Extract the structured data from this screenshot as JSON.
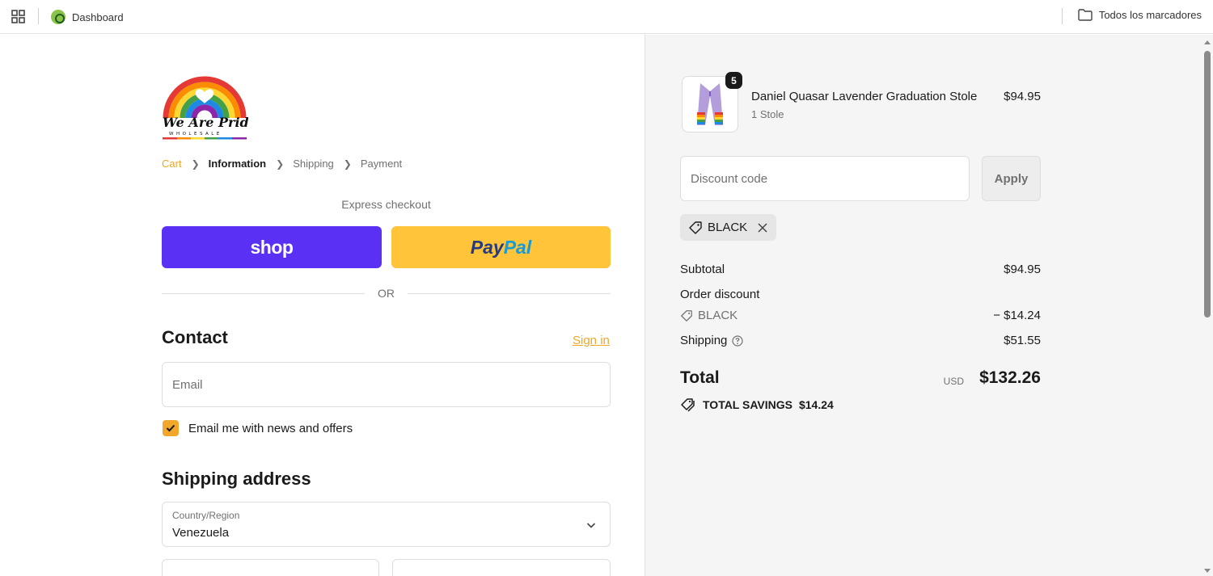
{
  "bookmarks": {
    "dashboard_label": "Dashboard",
    "all_bookmarks_label": "Todos los marcadores"
  },
  "brand": {
    "logo_text": "We Are Pride",
    "logo_subtext": "WHOLESALE"
  },
  "breadcrumb": {
    "items": [
      "Cart",
      "Information",
      "Shipping",
      "Payment"
    ],
    "current": "Information"
  },
  "express": {
    "label": "Express checkout",
    "shop_label": "shop",
    "paypal_pay": "Pay",
    "paypal_pal": "Pal",
    "or_label": "OR"
  },
  "contact": {
    "title": "Contact",
    "sign_in_label": "Sign in",
    "email_placeholder": "Email",
    "newsletter_label": "Email me with news and offers",
    "newsletter_checked": true
  },
  "shipping_address": {
    "title": "Shipping address",
    "country_label": "Country/Region",
    "country_value": "Venezuela"
  },
  "summary": {
    "product": {
      "name": "Daniel Quasar Lavender Graduation Stole",
      "variant": "1 Stole",
      "price": "$94.95",
      "quantity": "5"
    },
    "discount_placeholder": "Discount code",
    "apply_label": "Apply",
    "applied_code": "BLACK",
    "subtotal_label": "Subtotal",
    "subtotal_value": "$94.95",
    "order_discount_label": "Order discount",
    "discount_code": "BLACK",
    "discount_value": "− $14.24",
    "shipping_label": "Shipping",
    "shipping_value": "$51.55",
    "total_label": "Total",
    "currency": "USD",
    "total_value": "$132.26",
    "savings_label": "TOTAL SAVINGS",
    "savings_value": "$14.24"
  },
  "colors": {
    "accent": "#f0a72a",
    "shop_purple": "#5a31f4",
    "paypal_yellow": "#ffc439",
    "summary_bg": "#f5f5f5"
  }
}
